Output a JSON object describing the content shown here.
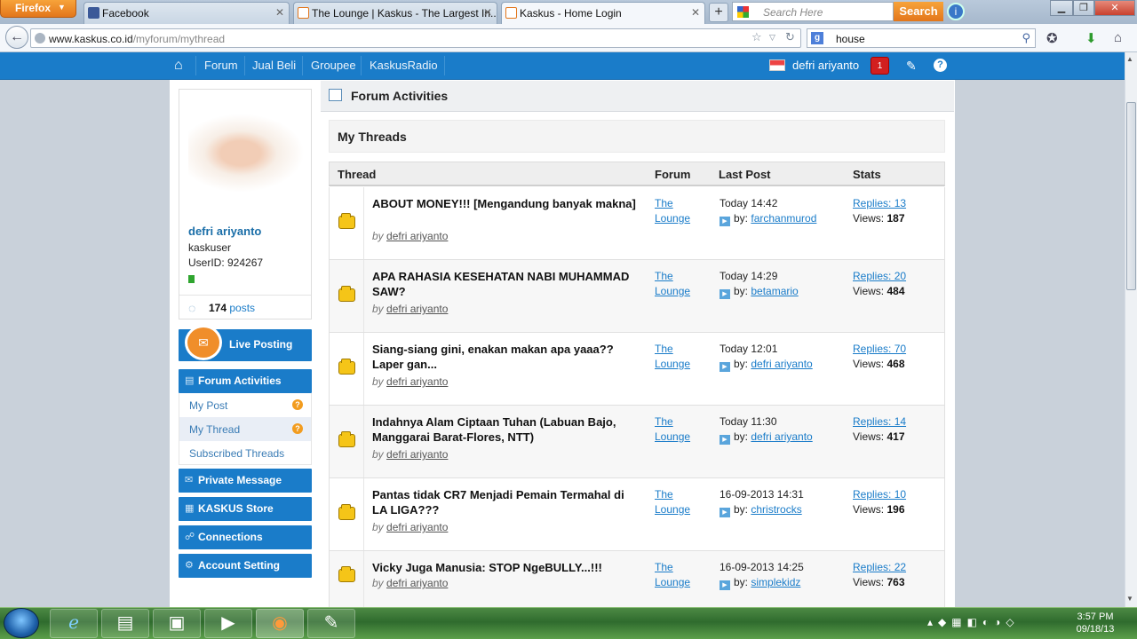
{
  "browser": {
    "menu_label": "Firefox",
    "tabs": [
      {
        "label": "Facebook",
        "active": false
      },
      {
        "label": "The Lounge | Kaskus - The Largest In...",
        "active": false
      },
      {
        "label": "Kaskus - Home Login",
        "active": true
      }
    ],
    "new_tab": "+",
    "search_placeholder": "Search Here",
    "search_button": "Search",
    "url_host": "www.kaskus.co.id",
    "url_path": "/myforum/mythread",
    "engine_query": "house"
  },
  "header": {
    "nav": [
      "Forum",
      "Jual Beli",
      "Groupee",
      "KaskusRadio"
    ],
    "username": "defri ariyanto",
    "notification_count": "1"
  },
  "profile": {
    "name": "defri ariyanto",
    "role": "kaskuser",
    "user_id": "UserID: 924267",
    "post_count": "174",
    "posts_label": "posts"
  },
  "sidebar": {
    "live_posting": "Live Posting",
    "forum_activities": "Forum Activities",
    "sub_items": [
      {
        "label": "My Post",
        "badge": "?"
      },
      {
        "label": "My Thread",
        "badge": "?"
      },
      {
        "label": "Subscribed Threads",
        "badge": ""
      }
    ],
    "private_message": "Private Message",
    "kaskus_store": "KASKUS Store",
    "connections": "Connections",
    "account_setting": "Account Setting"
  },
  "main": {
    "section_title": "Forum Activities",
    "box_title": "My Threads",
    "columns": [
      "Thread",
      "Forum",
      "Last Post",
      "Stats"
    ],
    "rows": [
      {
        "title": "ABOUT MONEY!!! [Mengandung banyak makna]",
        "by_label": "by",
        "author": "defri ariyanto",
        "forum": "The Lounge",
        "last_time": "Today 14:42",
        "by_prefix": "by:",
        "last_by": "farchanmurod",
        "replies": "Replies: 13",
        "views_label": "Views:",
        "views": "187"
      },
      {
        "title": "APA RAHASIA KESEHATAN NABI MUHAMMAD SAW?",
        "by_label": "by",
        "author": "defri ariyanto",
        "forum": "The Lounge",
        "last_time": "Today 14:29",
        "by_prefix": "by:",
        "last_by": "betamario",
        "replies": "Replies: 20",
        "views_label": "Views:",
        "views": "484"
      },
      {
        "title": "Siang-siang gini, enakan makan apa yaaa?? Laper gan...",
        "by_label": "by",
        "author": "defri ariyanto",
        "forum": "The Lounge",
        "last_time": "Today 12:01",
        "by_prefix": "by:",
        "last_by": "defri ariyanto",
        "replies": "Replies: 70",
        "views_label": "Views:",
        "views": "468"
      },
      {
        "title": "Indahnya Alam Ciptaan Tuhan (Labuan Bajo, Manggarai Barat-Flores, NTT)",
        "by_label": "by",
        "author": "defri ariyanto",
        "forum": "The Lounge",
        "last_time": "Today 11:30",
        "by_prefix": "by:",
        "last_by": "defri ariyanto",
        "replies": "Replies: 14",
        "views_label": "Views:",
        "views": "417"
      },
      {
        "title": "Pantas tidak CR7 Menjadi Pemain Termahal di LA LIGA???",
        "by_label": "by",
        "author": "defri ariyanto",
        "forum": "The Lounge",
        "last_time": "16-09-2013 14:31",
        "by_prefix": "by:",
        "last_by": "christrocks",
        "replies": "Replies: 10",
        "views_label": "Views:",
        "views": "196"
      },
      {
        "title": "Vicky Juga Manusia: STOP NgeBULLY...!!!",
        "by_label": "by",
        "author": "defri ariyanto",
        "forum": "The Lounge",
        "last_time": "16-09-2013 14:25",
        "by_prefix": "by:",
        "last_by": "simplekidz",
        "replies": "Replies: 22",
        "views_label": "Views:",
        "views": "763"
      }
    ]
  },
  "taskbar": {
    "time": "3:57 PM",
    "date": "09/18/13"
  },
  "colors": {
    "kaskus_blue": "#1a7cc9",
    "firefox_orange": "#e3761b",
    "notification_red": "#d21f1f"
  }
}
